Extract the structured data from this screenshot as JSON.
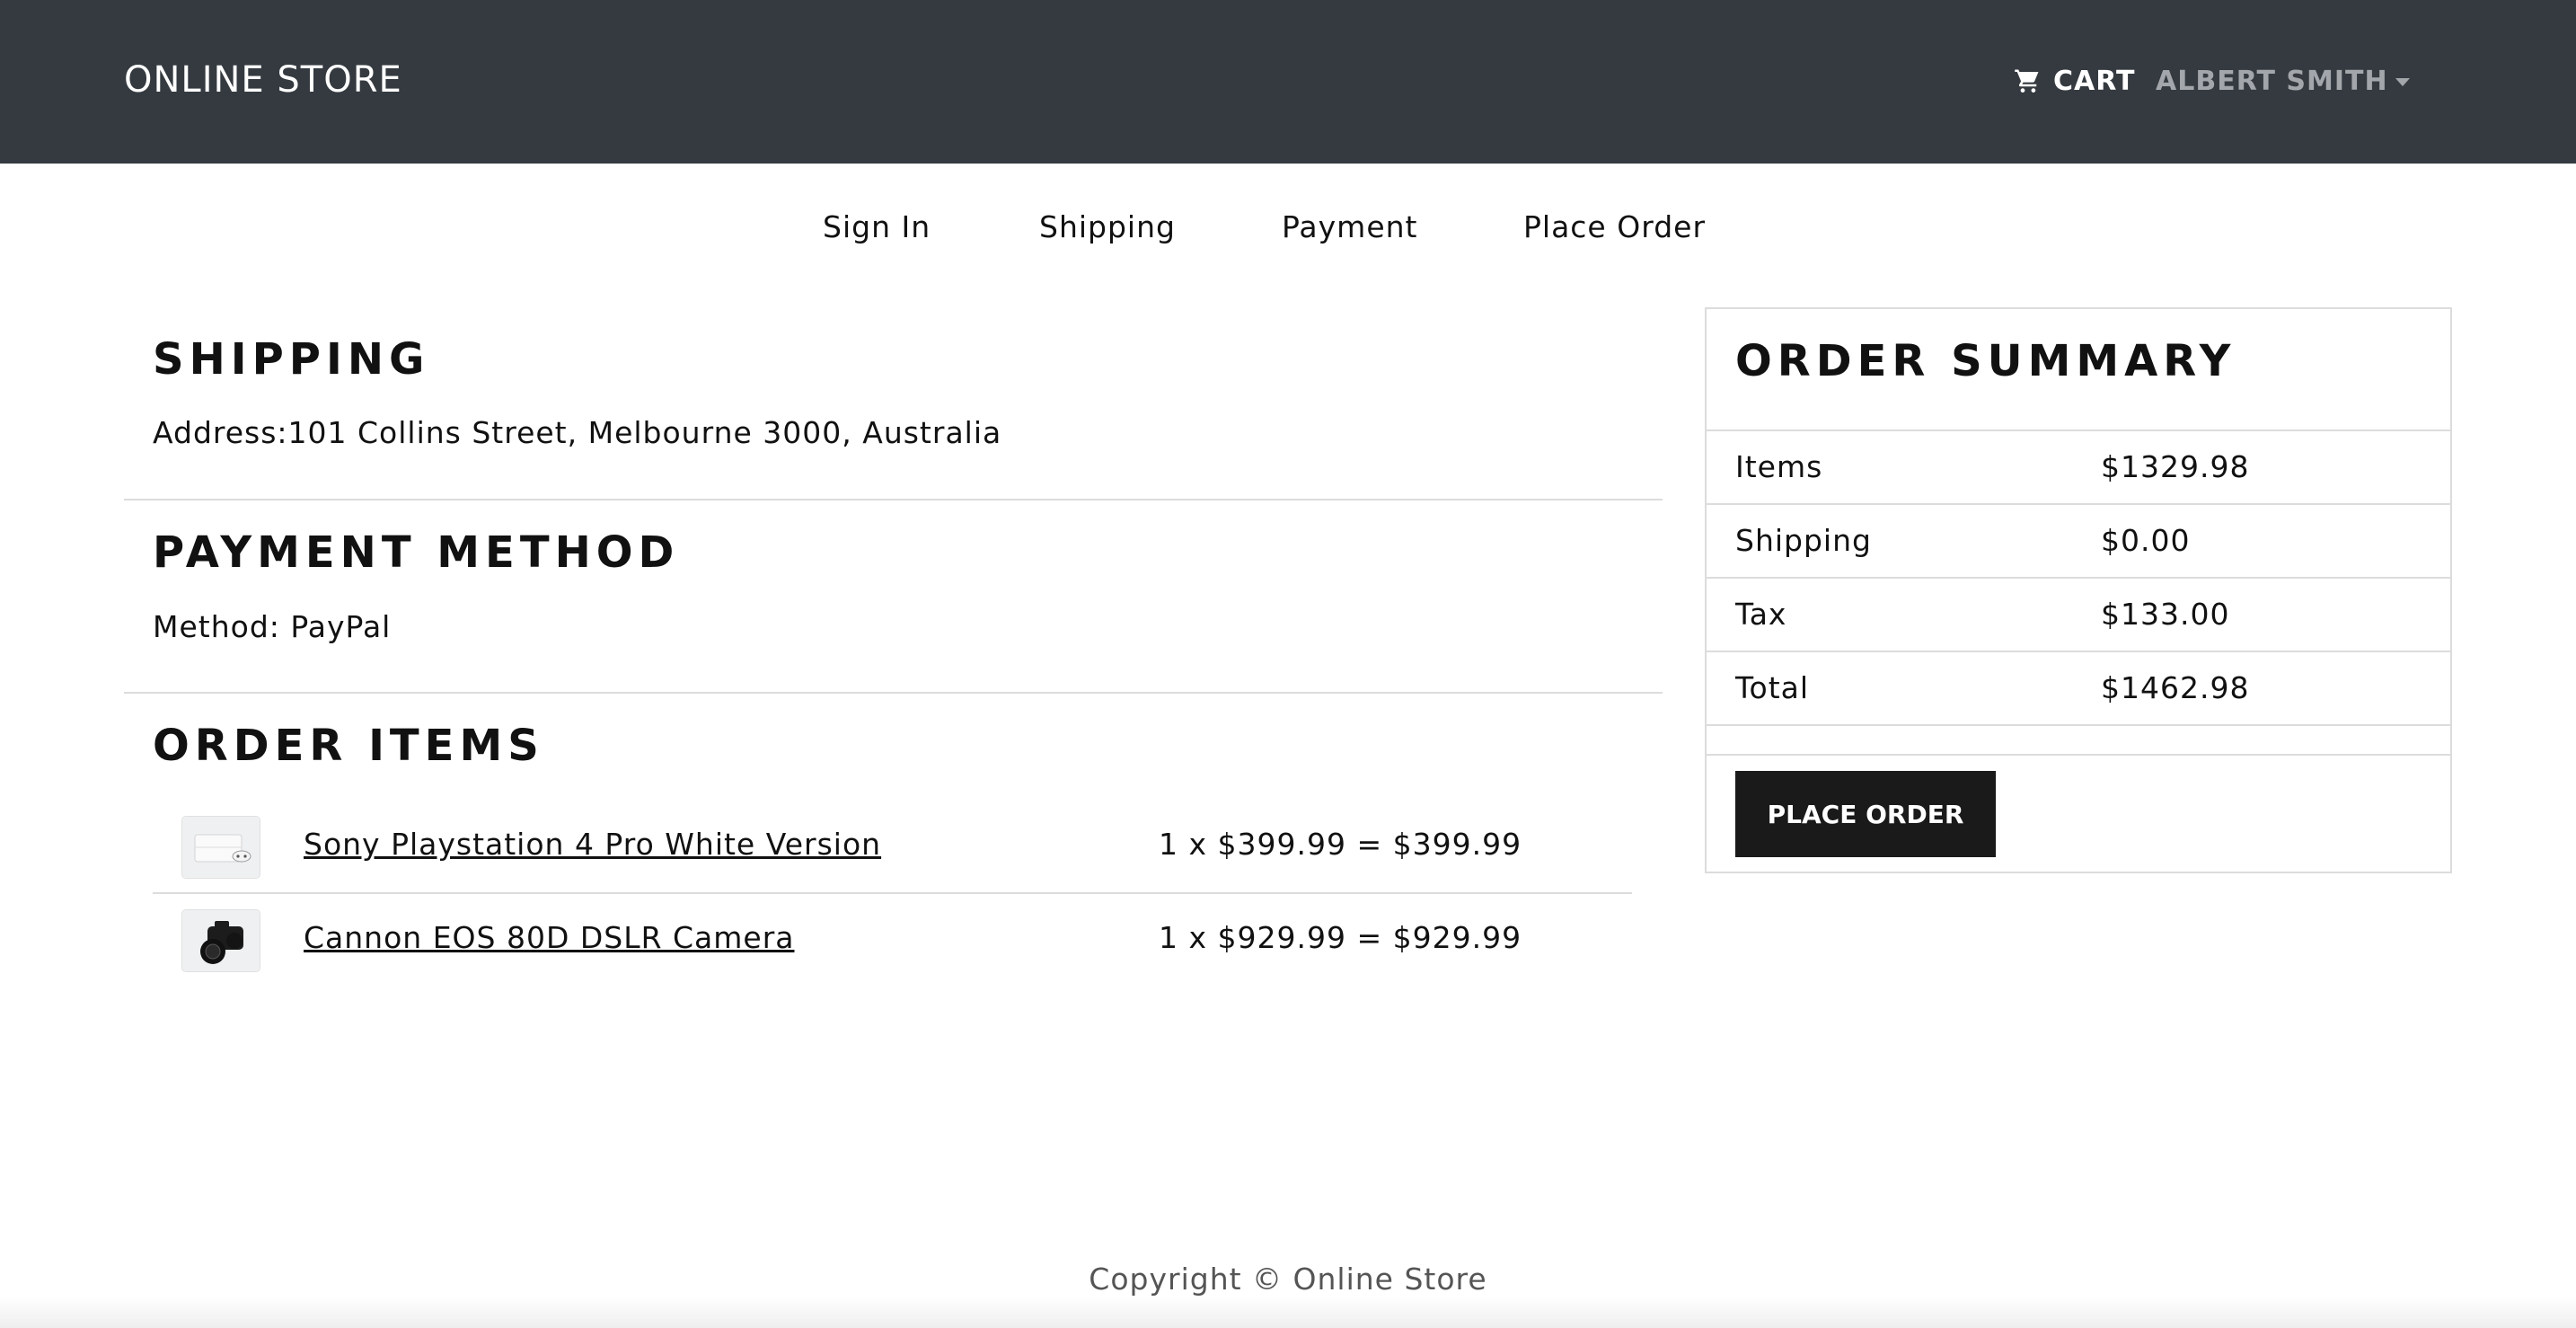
{
  "navbar": {
    "brand": "ONLINE STORE",
    "cart_label": "CART",
    "cart_icon": "shopping-cart-icon",
    "user_name": "ALBERT SMITH"
  },
  "steps": [
    "Sign In",
    "Shipping",
    "Payment",
    "Place Order"
  ],
  "shipping": {
    "title": "SHIPPING",
    "address": "Address:101 Collins Street, Melbourne 3000, Australia"
  },
  "payment": {
    "title": "PAYMENT METHOD",
    "method": "Method: PayPal"
  },
  "order_items": {
    "title": "ORDER ITEMS",
    "items": [
      {
        "name": "Sony Playstation 4 Pro White Version",
        "price_line": "1 x $399.99 = $399.99",
        "thumb": "playstation-thumbnail"
      },
      {
        "name": "Cannon EOS 80D DSLR Camera",
        "price_line": "1 x $929.99 = $929.99",
        "thumb": "camera-thumbnail"
      }
    ]
  },
  "summary": {
    "title": "ORDER SUMMARY",
    "rows": [
      {
        "label": "Items",
        "value": "$1329.98"
      },
      {
        "label": "Shipping",
        "value": "$0.00"
      },
      {
        "label": "Tax",
        "value": "$133.00"
      },
      {
        "label": "Total",
        "value": "$1462.98"
      }
    ],
    "button_label": "PLACE ORDER"
  },
  "footer": {
    "copyright": "Copyright © Online Store"
  },
  "colors": {
    "navbar_bg": "#343a40",
    "button_bg": "#1a1a1a",
    "user_link": "#a3a7ab"
  }
}
